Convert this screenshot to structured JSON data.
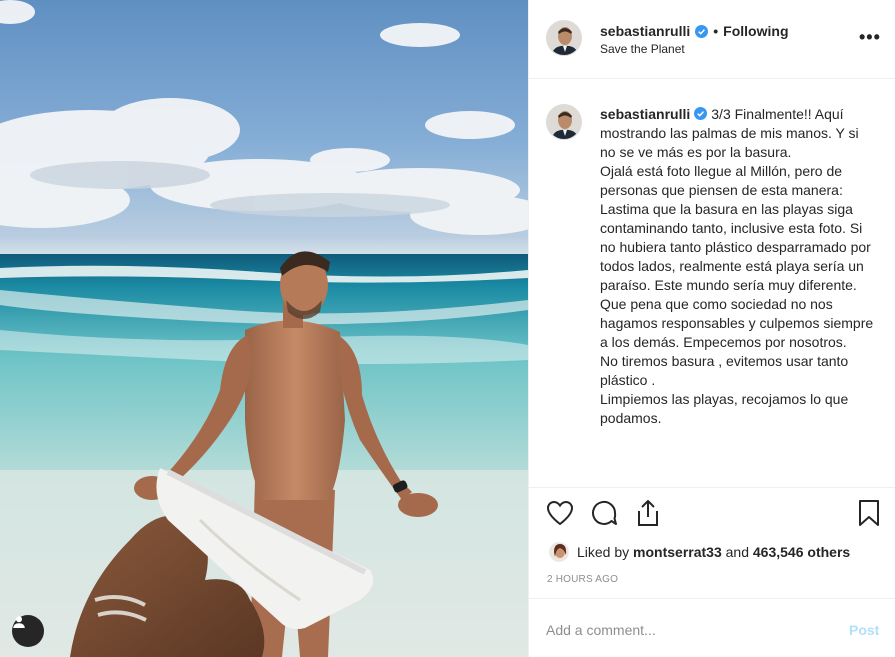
{
  "post": {
    "author": "sebastianrulli",
    "verified": true,
    "separator": "•",
    "follow_status": "Following",
    "location": "Save the Planet",
    "more_label": "•••",
    "caption": "3/3 Finalmente!! Aquí mostrando las palmas de mis manos. Y si no se ve más es por la basura.\nOjalá está foto llegue al Millón, pero de personas que piensen de esta manera:\nLastima que la basura en las playas siga contaminando tanto, inclusive esta foto. Si no hubiera tanto plástico desparramado por todos lados, realmente está playa sería un paraíso. Este mundo sería muy diferente. Que pena que como sociedad no nos hagamos responsables y culpemos siempre a los demás. Empecemos por nosotros.\nNo tiremos basura , evitemos usar tanto plástico .\nLimpiemos las playas, recojamos lo que podamos.",
    "likes": {
      "prefix": "Liked by",
      "user": "montserrat33",
      "joiner": "and",
      "others": "463,546 others"
    },
    "timestamp": "2 HOURS AGO"
  },
  "comment_box": {
    "placeholder": "Add a comment...",
    "post_label": "Post"
  },
  "icons": {
    "like": "heart-icon",
    "comment": "comment-icon",
    "share": "share-icon",
    "save": "bookmark-icon",
    "user_tags": "user-icon",
    "verified": "verified-badge-icon"
  },
  "colors": {
    "verified": "#3897f0",
    "text": "#262626",
    "muted": "#8e8e8e",
    "post_disabled": "#b2dffc",
    "border": "#efefef"
  }
}
